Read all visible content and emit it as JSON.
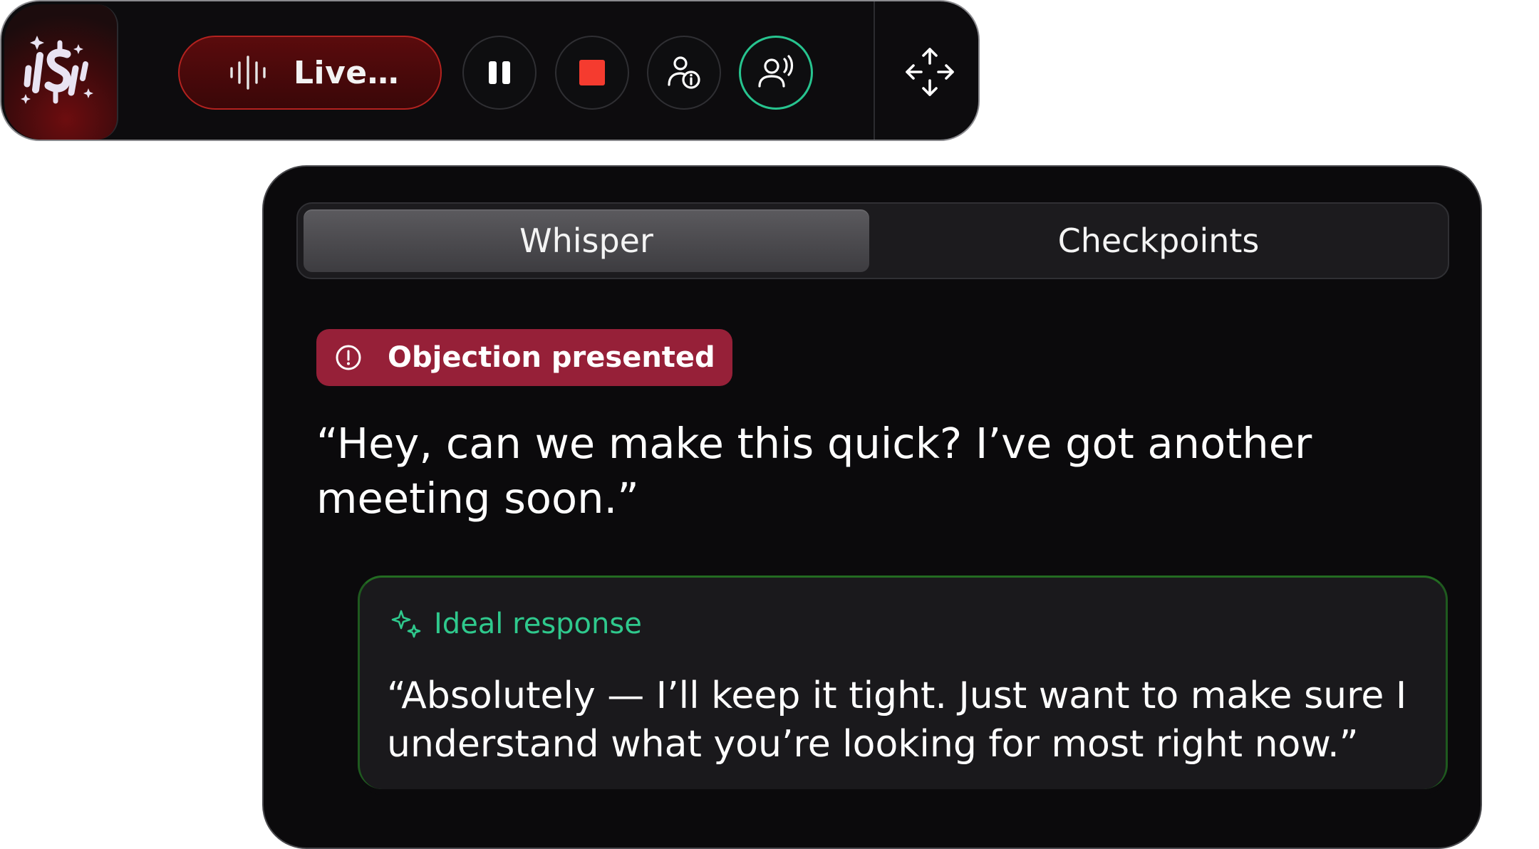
{
  "toolbar": {
    "logo": "sparkle-dollar-logo",
    "status_label": "Live…",
    "buttons": [
      {
        "name": "pause",
        "icon": "pause-icon"
      },
      {
        "name": "stop",
        "icon": "stop-icon",
        "color": "#f53b2f"
      },
      {
        "name": "user-info",
        "icon": "user-info-icon"
      },
      {
        "name": "speaker",
        "icon": "user-voice-icon",
        "accent": "#27c48f"
      },
      {
        "name": "move",
        "icon": "move-arrows-icon"
      }
    ],
    "live_border_color": "#b3221f"
  },
  "panel": {
    "tabs": [
      {
        "label": "Whisper",
        "active": true
      },
      {
        "label": "Checkpoints",
        "active": false
      }
    ],
    "badge": {
      "label": "Objection presented",
      "icon": "alert-circle-icon",
      "color": "#962038"
    },
    "quote": "“Hey, can we make this quick? I’ve got another meeting soon.”",
    "response": {
      "title": "Ideal response",
      "icon": "sparkles-icon",
      "title_color": "#2fc98d",
      "text": "“Absolutely — I’ll keep it tight. Just want to make sure I understand what you’re looking for most right now.”"
    }
  }
}
